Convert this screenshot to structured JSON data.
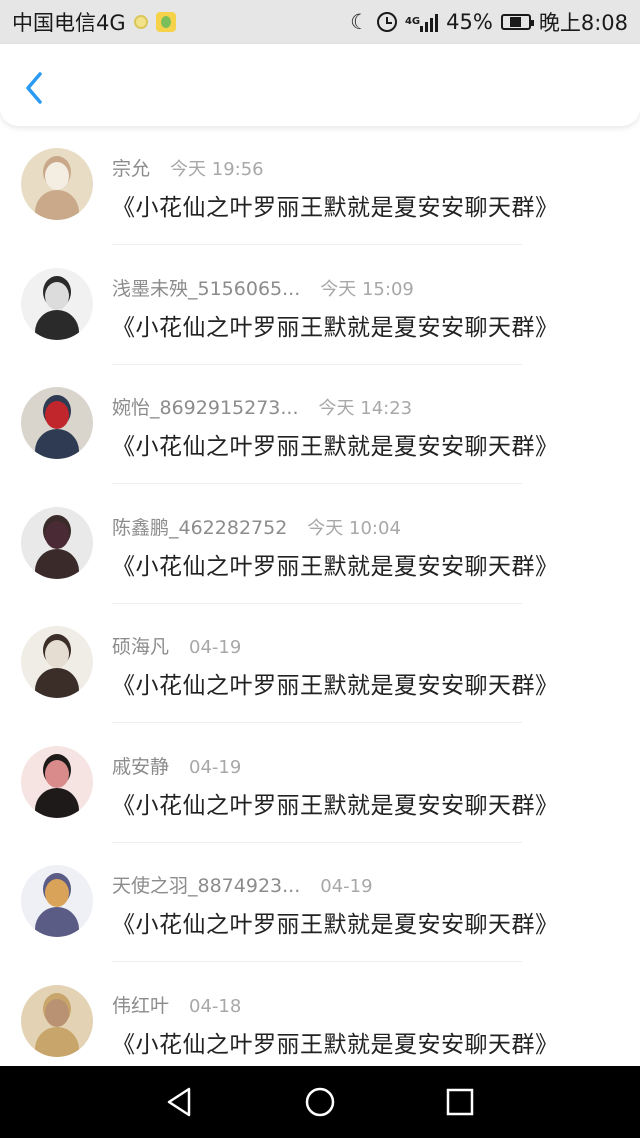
{
  "status_bar": {
    "carrier": "中国电信4G",
    "network_small": "4G",
    "battery": "45%",
    "time": "晚上8:08",
    "battery_level": 0.45
  },
  "header": {
    "back_icon": "chevron-left-icon",
    "accent_color": "#2b9af3"
  },
  "messages": [
    {
      "name": "宗允",
      "time": "今天 19:56",
      "text": "《小花仙之叶罗丽王默就是夏安安聊天群》",
      "avatar_colors": [
        "#e8dcc4",
        "#c9a98a",
        "#f3ede2"
      ]
    },
    {
      "name": "浅墨未殃_5156065...",
      "time": "今天 15:09",
      "text": "《小花仙之叶罗丽王默就是夏安安聊天群》",
      "avatar_colors": [
        "#f1f1f1",
        "#2a2a2a",
        "#dcdcdc"
      ]
    },
    {
      "name": "婉怡_8692915273...",
      "time": "今天 14:23",
      "text": "《小花仙之叶罗丽王默就是夏安安聊天群》",
      "avatar_colors": [
        "#d9d4cc",
        "#2f3b52",
        "#c0262b"
      ]
    },
    {
      "name": "陈鑫鹏_462282752",
      "time": "今天 10:04",
      "text": "《小花仙之叶罗丽王默就是夏安安聊天群》",
      "avatar_colors": [
        "#e9e9e9",
        "#3a2a2a",
        "#4a2a35"
      ]
    },
    {
      "name": "硕海凡",
      "time": "04-19",
      "text": "《小花仙之叶罗丽王默就是夏安安聊天群》",
      "avatar_colors": [
        "#f0ece6",
        "#3b2d28",
        "#e6ddd2"
      ]
    },
    {
      "name": "戚安静",
      "time": "04-19",
      "text": "《小花仙之叶罗丽王默就是夏安安聊天群》",
      "avatar_colors": [
        "#f6e4e2",
        "#1e1a1a",
        "#d98a8a"
      ]
    },
    {
      "name": "天使之羽_8874923...",
      "time": "04-19",
      "text": "《小花仙之叶罗丽王默就是夏安安聊天群》",
      "avatar_colors": [
        "#eef0f5",
        "#5a5c86",
        "#d9a35a"
      ]
    },
    {
      "name": "伟红叶",
      "time": "04-18",
      "text": "《小花仙之叶罗丽王默就是夏安安聊天群》",
      "avatar_colors": [
        "#e3d3b4",
        "#c8a56a",
        "#b89272"
      ]
    }
  ],
  "nav": {
    "back_icon": "triangle-back-icon",
    "home_icon": "circle-home-icon",
    "recent_icon": "square-recent-icon"
  }
}
